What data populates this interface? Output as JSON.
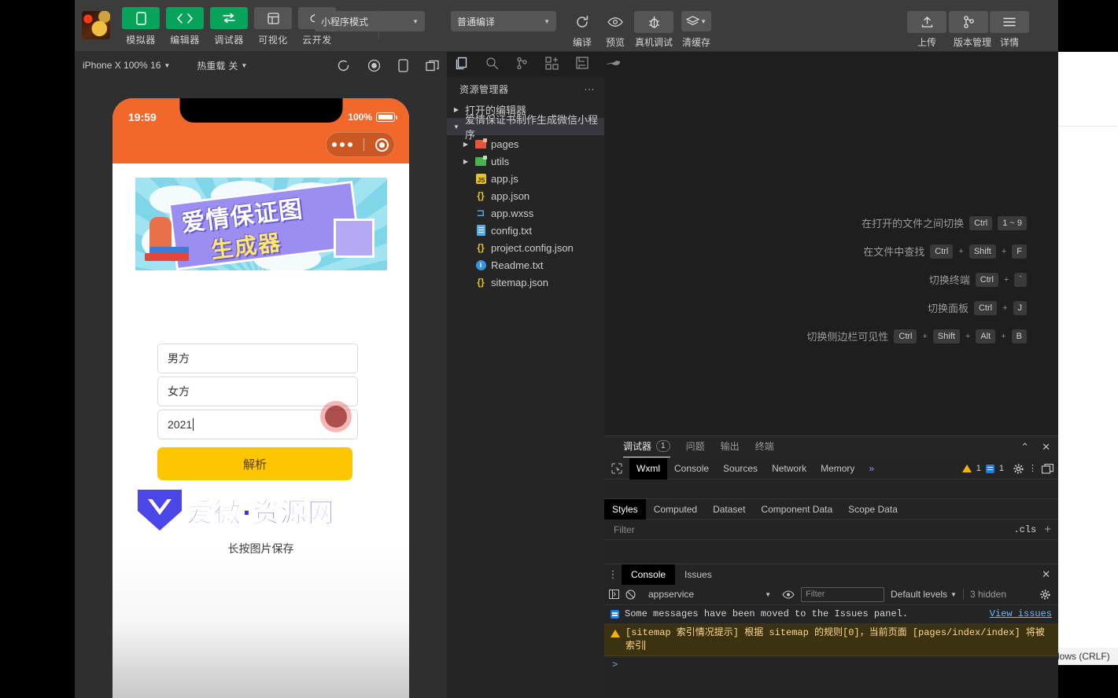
{
  "toolbar": {
    "main_buttons": [
      {
        "label": "模拟器",
        "icon": "phone-icon",
        "state": "green"
      },
      {
        "label": "编辑器",
        "icon": "code-icon",
        "state": "green"
      },
      {
        "label": "调试器",
        "icon": "debug-icon",
        "state": "green"
      },
      {
        "label": "可视化",
        "icon": "layout-icon",
        "state": "grey"
      },
      {
        "label": "云开发",
        "icon": "cloud-icon",
        "state": "grey"
      }
    ],
    "mode_select": "小程序模式",
    "compile_select": "普通编译",
    "actions": [
      {
        "label": "编译",
        "icon": "refresh-icon"
      },
      {
        "label": "预览",
        "icon": "eye-icon"
      },
      {
        "label": "真机调试",
        "icon": "bug-icon"
      },
      {
        "label": "清缓存",
        "icon": "layers-icon"
      }
    ],
    "right_actions": [
      {
        "label": "上传",
        "icon": "upload-icon"
      },
      {
        "label": "版本管理",
        "icon": "branch-icon"
      },
      {
        "label": "详情",
        "icon": "menu-icon"
      }
    ]
  },
  "simulator": {
    "device": "iPhone X 100% 16",
    "hot_reload_label": "热重载",
    "hot_reload_value": "关",
    "icons": [
      "refresh-icon",
      "record-icon",
      "rotate-icon",
      "detach-icon"
    ],
    "phone": {
      "status_time": "19:59",
      "battery_percent": "100%",
      "banner_title_1": "爱情保证图",
      "banner_title_2": "生成器",
      "fields": [
        {
          "value": "男方",
          "name": "male-name-input"
        },
        {
          "value": "女方",
          "name": "female-name-input"
        },
        {
          "value": "2021",
          "name": "year-input",
          "has_cursor": true
        }
      ],
      "button_label": "解析",
      "watermark_text": "爱微·资源网",
      "caption": "长按图片保存"
    }
  },
  "activity_bar": {
    "icons": [
      "explorer-icon",
      "search-icon",
      "source-control-icon",
      "extensions-icon",
      "save-icon",
      "cloud-whale-icon"
    ]
  },
  "explorer": {
    "title": "资源管理器",
    "more": "···",
    "sections": [
      {
        "label": "打开的编辑器",
        "expanded": false
      },
      {
        "label": "爱情保证书制作生成微信小程序",
        "expanded": true
      }
    ],
    "tree": [
      {
        "label": "pages",
        "icon": "folder-red-icon",
        "type": "folder",
        "expanded": false
      },
      {
        "label": "utils",
        "icon": "folder-green-icon",
        "type": "folder",
        "expanded": false
      },
      {
        "label": "app.js",
        "icon": "js-icon",
        "type": "file"
      },
      {
        "label": "app.json",
        "icon": "json-icon",
        "type": "file"
      },
      {
        "label": "app.wxss",
        "icon": "wxss-icon",
        "type": "file"
      },
      {
        "label": "config.txt",
        "icon": "text-file-icon",
        "type": "file"
      },
      {
        "label": "project.config.json",
        "icon": "json-icon",
        "type": "file"
      },
      {
        "label": "Readme.txt",
        "icon": "info-file-icon",
        "type": "file"
      },
      {
        "label": "sitemap.json",
        "icon": "json-icon",
        "type": "file"
      }
    ]
  },
  "shortcuts": [
    {
      "label": "在打开的文件之间切换",
      "keys": [
        "Ctrl",
        "1 ~ 9"
      ],
      "separators": false
    },
    {
      "label": "在文件中查找",
      "keys": [
        "Ctrl",
        "Shift",
        "F"
      ],
      "separators": true
    },
    {
      "label": "切换终端",
      "keys": [
        "Ctrl",
        "`"
      ],
      "separators": true
    },
    {
      "label": "切换面板",
      "keys": [
        "Ctrl",
        "J"
      ],
      "separators": true
    },
    {
      "label": "切换侧边栏可见性",
      "keys": [
        "Ctrl",
        "Shift",
        "Alt",
        "B"
      ],
      "separators": true
    }
  ],
  "debugger": {
    "panel_tabs": [
      {
        "label": "调试器",
        "badge": "1",
        "active": true
      },
      {
        "label": "问题",
        "active": false
      },
      {
        "label": "输出",
        "active": false
      },
      {
        "label": "终端",
        "active": false
      }
    ],
    "collapse_icon": "chevron-up-icon",
    "close_icon": "close-icon",
    "devtools_tabs": [
      {
        "label": "Wxml",
        "active": true
      },
      {
        "label": "Console",
        "active": false
      },
      {
        "label": "Sources",
        "active": false
      },
      {
        "label": "Network",
        "active": false
      },
      {
        "label": "Memory",
        "active": false
      }
    ],
    "more_tabs": "»",
    "warning_count": "1",
    "info_count": "1",
    "styles_tabs": [
      {
        "label": "Styles",
        "active": true
      },
      {
        "label": "Computed",
        "active": false
      },
      {
        "label": "Dataset",
        "active": false
      },
      {
        "label": "Component Data",
        "active": false
      },
      {
        "label": "Scope Data",
        "active": false
      }
    ],
    "styles_filter_placeholder": "Filter",
    "cls_label": ".cls",
    "console": {
      "tabs": [
        {
          "label": "Console",
          "active": true
        },
        {
          "label": "Issues",
          "active": false
        }
      ],
      "context": "appservice",
      "filter_placeholder": "Filter",
      "levels": "Default levels",
      "hidden": "3 hidden",
      "messages": [
        {
          "type": "info",
          "text": "Some messages have been moved to the Issues panel.",
          "link": "View issues"
        },
        {
          "type": "warning",
          "text": "[sitemap 索引情况提示] 根据 sitemap 的规则[0]，当前页面 [pages/index/index] 将被索引"
        }
      ],
      "prompt": ">"
    }
  },
  "background_window": {
    "status_text": "dows (CRLF)"
  },
  "colors": {
    "accent_green": "#07a35a",
    "phone_header_orange": "#f2682a",
    "button_yellow": "#fdc600",
    "warning_yellow": "#f2b600"
  }
}
